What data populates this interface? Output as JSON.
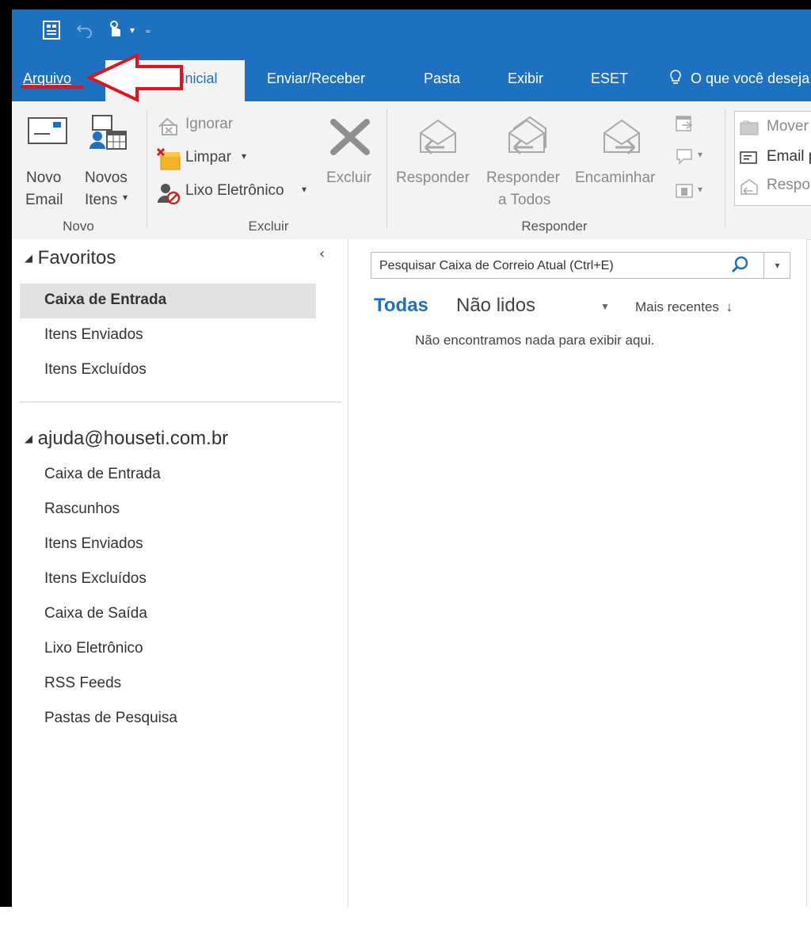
{
  "tabs": {
    "file": "Arquivo",
    "home": "Página Inicial",
    "send_receive": "Enviar/Receber",
    "folder": "Pasta",
    "view": "Exibir",
    "eset": "ESET",
    "tell_me": "O que você deseja fazer?"
  },
  "ribbon": {
    "new_group": {
      "label": "Novo",
      "new_email_line1": "Novo",
      "new_email_line2": "Email",
      "new_items_line1": "Novos",
      "new_items_line2": "Itens"
    },
    "delete_group": {
      "label": "Excluir",
      "ignore": "Ignorar",
      "clean": "Limpar",
      "junk": "Lixo Eletrônico",
      "delete": "Excluir"
    },
    "respond_group": {
      "label": "Responder",
      "reply": "Responder",
      "reply_all_line1": "Responder",
      "reply_all_line2": "a Todos",
      "forward": "Encaminhar"
    },
    "quick_steps": {
      "move": "Mover para: ?",
      "email": "Email para o Gerente",
      "reply": "Responder e Excluir"
    }
  },
  "nav": {
    "favorites_header": "Favoritos",
    "favorites": [
      "Caixa de Entrada",
      "Itens Enviados",
      "Itens Excluídos"
    ],
    "account_header": "ajuda@houseti.com.br",
    "account_folders": [
      "Caixa de Entrada",
      "Rascunhos",
      "Itens Enviados",
      "Itens Excluídos",
      "Caixa de Saída",
      "Lixo Eletrônico",
      "RSS Feeds",
      "Pastas de Pesquisa"
    ]
  },
  "list": {
    "search_placeholder": "Pesquisar Caixa de Correio Atual (Ctrl+E)",
    "filter_all": "Todas",
    "filter_unread": "Não lidos",
    "sort": "Mais recentes",
    "empty_message": "Não encontramos nada para exibir aqui."
  },
  "colors": {
    "accent": "#1e70c1",
    "annotation_arrow": "#e0141e"
  }
}
